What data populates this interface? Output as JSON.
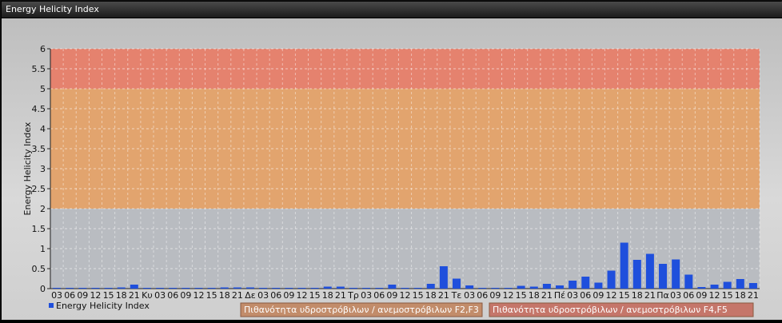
{
  "window": {
    "title": "Energy Helicity Index"
  },
  "chart_data": {
    "type": "bar",
    "ylabel": "Energy Helicity Index",
    "ylim": [
      0,
      6
    ],
    "yticks": [
      "0",
      "0.5",
      "1",
      "1.5",
      "2",
      "2.5",
      "3",
      "3.5",
      "4",
      "4.5",
      "5",
      "5.5",
      "6"
    ],
    "grid": true,
    "legend_position": "bottom-left",
    "bands": [
      {
        "from": 0,
        "to": 2,
        "color": "#b9bcc1"
      },
      {
        "from": 2,
        "to": 5,
        "color": "#e2a46e"
      },
      {
        "from": 5,
        "to": 6,
        "color": "#e5826e"
      }
    ],
    "categories": [
      "03",
      "06",
      "09",
      "12",
      "15",
      "18",
      "21",
      "Κυ",
      "03",
      "06",
      "09",
      "12",
      "15",
      "18",
      "21",
      "Δε",
      "03",
      "06",
      "09",
      "12",
      "15",
      "18",
      "21",
      "Τρ",
      "03",
      "06",
      "09",
      "12",
      "15",
      "18",
      "21",
      "Τε",
      "03",
      "06",
      "09",
      "12",
      "15",
      "18",
      "21",
      "Πέ",
      "03",
      "06",
      "09",
      "12",
      "15",
      "18",
      "21",
      "Πα",
      "03",
      "06",
      "09",
      "12",
      "15",
      "18",
      "21"
    ],
    "series": [
      {
        "name": "Energy Helicity Index",
        "color": "#1f4fdc",
        "values": [
          0.02,
          0.02,
          0.02,
          0.02,
          0.02,
          0.03,
          0.1,
          0.02,
          0.02,
          0.02,
          0.02,
          0.02,
          0.02,
          0.03,
          0.03,
          0.03,
          0.02,
          0.02,
          0.02,
          0.02,
          0.02,
          0.05,
          0.05,
          0.02,
          0.02,
          0.02,
          0.1,
          0.02,
          0.02,
          0.12,
          0.56,
          0.25,
          0.08,
          0.02,
          0.02,
          0.02,
          0.07,
          0.05,
          0.12,
          0.08,
          0.2,
          0.3,
          0.15,
          0.45,
          1.15,
          0.72,
          0.87,
          0.62,
          0.73,
          0.35,
          0.04,
          0.1,
          0.17,
          0.24,
          0.14
        ]
      }
    ]
  },
  "legend": [
    {
      "label": "Πιθανότητα υδροστρόβιλων / ανεμοστρόβιλων F2,F3",
      "color": "#c28c6a"
    },
    {
      "label": "Πιθανότητα υδροστρόβιλων / ανεμοστρόβιλων F4,F5",
      "color": "#c5766a"
    }
  ]
}
